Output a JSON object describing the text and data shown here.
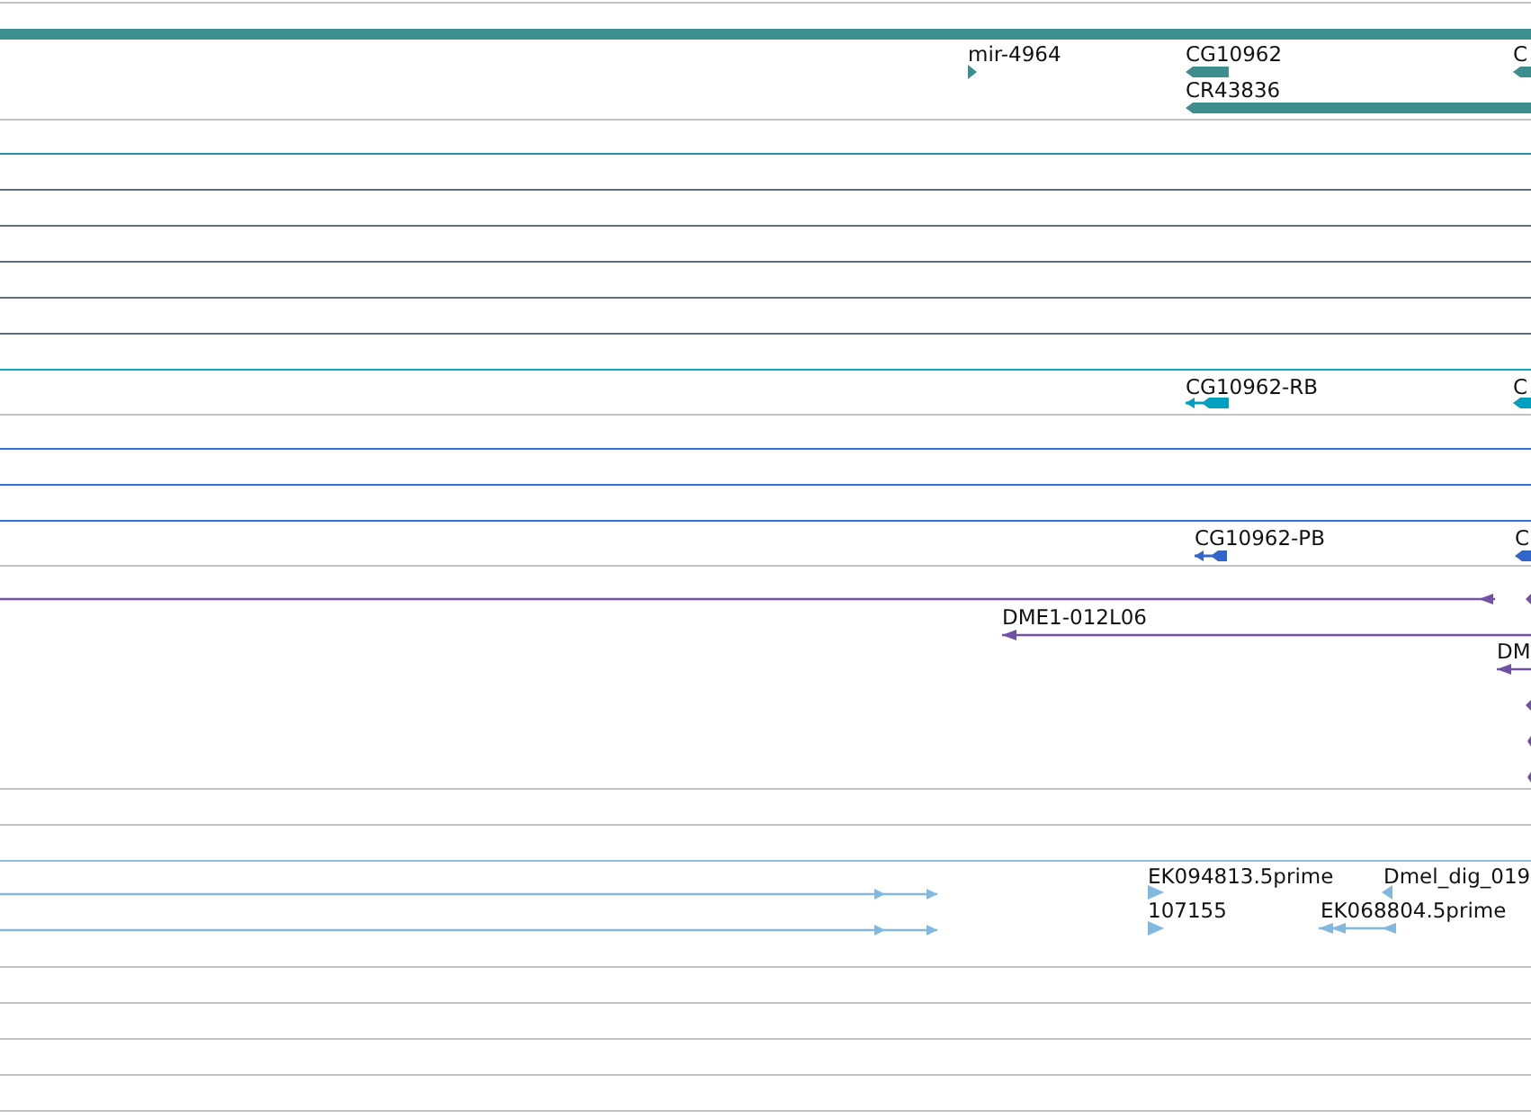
{
  "gridlines": [
    {
      "kind": "plain"
    },
    {
      "kind": "plain"
    },
    {
      "kind": "teal"
    },
    {
      "kind": "slate"
    },
    {
      "kind": "slate"
    },
    {
      "kind": "slate"
    },
    {
      "kind": "slate"
    },
    {
      "kind": "slate"
    },
    {
      "kind": "cyan"
    },
    {
      "kind": "plain"
    },
    {
      "kind": "blue"
    },
    {
      "kind": "blue"
    },
    {
      "kind": "blue"
    },
    {
      "kind": "plain"
    },
    {
      "kind": "plain"
    },
    {
      "kind": "plain"
    },
    {
      "kind": "lightblue"
    },
    {
      "kind": "plain"
    },
    {
      "kind": "plain"
    },
    {
      "kind": "plain"
    },
    {
      "kind": "plain"
    },
    {
      "kind": "plain"
    }
  ],
  "features": [
    {
      "kind": "bar",
      "color": "#3d8e8e"
    },
    {
      "kind": "tri-right",
      "color": "#3d8e8e",
      "label": "mir-4964"
    },
    {
      "kind": "block-left",
      "color": "#3d8e8e",
      "label": "CG10962"
    },
    {
      "kind": "block-left",
      "color": "#3d8e8e",
      "label": "C"
    },
    {
      "kind": "block-left",
      "color": "#3d8e8e",
      "label": "CR43836"
    },
    {
      "kind": "exons-left",
      "color": "#00a0c0",
      "label": "CG10962-RB"
    },
    {
      "kind": "block-left",
      "color": "#00a0c0",
      "label": "C"
    },
    {
      "kind": "exons-left",
      "color": "#3366cc",
      "label": "CG10962-PB"
    },
    {
      "kind": "block-left",
      "color": "#3366cc",
      "label": "C"
    },
    {
      "kind": "line-left",
      "color": "#7050a8"
    },
    {
      "kind": "block-left",
      "color": "#7050a8"
    },
    {
      "kind": "line-left",
      "color": "#7050a8",
      "label": "DME1-012L06"
    },
    {
      "kind": "line-left",
      "color": "#7050a8",
      "label": "DM"
    },
    {
      "kind": "block-left",
      "color": "#7050a8"
    },
    {
      "kind": "block-left",
      "color": "#7050a8"
    },
    {
      "kind": "block-left",
      "color": "#7050a8"
    },
    {
      "kind": "line-right",
      "color": "#80b8e0"
    },
    {
      "kind": "line-right",
      "color": "#80b8e0"
    },
    {
      "kind": "tri-right",
      "color": "#80b8e0",
      "label": "EK094813.5prime"
    },
    {
      "kind": "tri-right",
      "color": "#80b8e0",
      "label": "107155"
    },
    {
      "kind": "tri-left",
      "color": "#80b8e0",
      "label": "Dmel_dig_019"
    },
    {
      "kind": "line-left",
      "color": "#80b8e0",
      "label": "EK068804.5prime"
    }
  ]
}
